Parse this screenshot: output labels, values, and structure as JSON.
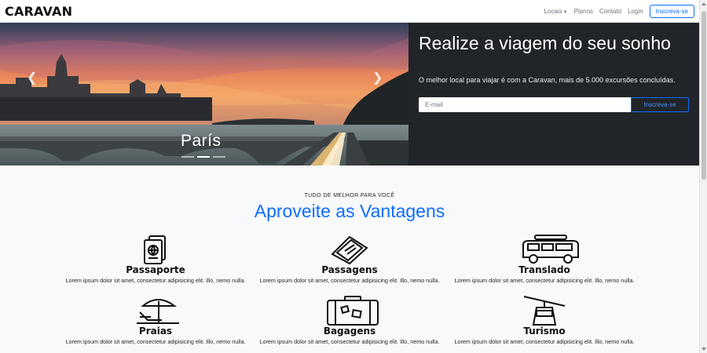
{
  "navbar": {
    "brand": "CARAVAN",
    "links": [
      {
        "label": "Locais"
      },
      {
        "label": "Planos"
      },
      {
        "label": "Contato"
      },
      {
        "label": "Login"
      }
    ],
    "cta": "Inscreva-se"
  },
  "carousel": {
    "caption": "París",
    "indicators": 3,
    "active_indicator": 2,
    "prev_icon": "chevron-left-icon",
    "next_icon": "chevron-right-icon"
  },
  "hero": {
    "title": "Realize a viagem do seu sonho",
    "subtitle": "O melhor local para viajar é com a Caravan, mais de 5.000 excursões concluídas.",
    "email_placeholder": "E-mail",
    "button": "Inscreva-se"
  },
  "features": {
    "eyebrow": "TUDO DE MELHOR PARA VOCÊ",
    "title": "Aproveite as Vantagens",
    "items": [
      {
        "title": "Passaporte",
        "icon": "passport-icon",
        "text": "Lorem ipsum dolor sit amet, consectetur adipisicing elit. Illo, nemo nulla."
      },
      {
        "title": "Passagens",
        "icon": "ticket-icon",
        "text": "Lorem ipsum dolor sit amet, consectetur adipisicing elit. Illo, nemo nulla."
      },
      {
        "title": "Translado",
        "icon": "van-icon",
        "text": "Lorem ipsum dolor sit amet, consectetur adipisicing elit. Illo, nemo nulla."
      },
      {
        "title": "Praias",
        "icon": "beach-umbrella-icon",
        "text": "Lorem ipsum dolor sit amet, consectetur adipisicing elit. Illo, nemo nulla."
      },
      {
        "title": "Bagagens",
        "icon": "luggage-icon",
        "text": "Lorem ipsum dolor sit amet, consectetur adipisicing elit. Illo, nemo nulla."
      },
      {
        "title": "Turismo",
        "icon": "cable-car-icon",
        "text": "Lorem ipsum dolor sit amet, consectetur adipisicing elit. Illo, nemo nulla."
      }
    ]
  }
}
